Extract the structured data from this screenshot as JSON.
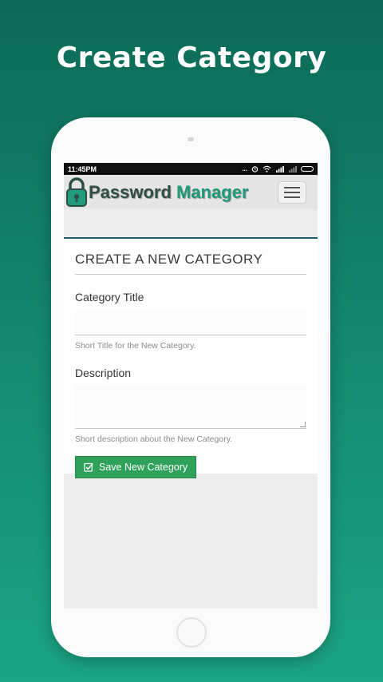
{
  "promo": {
    "title": "Create Category"
  },
  "status_bar": {
    "time": "11:45PM",
    "signal_dots": "..."
  },
  "app": {
    "logo_word_1": "Password",
    "logo_word_2": "Manager"
  },
  "form": {
    "heading": "CREATE A NEW CATEGORY",
    "title_label": "Category Title",
    "title_value": "",
    "title_help": "Short Title for the New Category.",
    "description_label": "Description",
    "description_value": "",
    "description_help": "Short description about the New Category.",
    "save_label": "Save New Category"
  },
  "colors": {
    "background_top": "#0c6a57",
    "background_bottom": "#1aa583",
    "brand_green": "#1f9b79",
    "button_green": "#2ea25a"
  },
  "icons": [
    "lock-icon",
    "wifi-icon",
    "signal-icon",
    "alarm-icon",
    "battery-icon",
    "menu-icon",
    "check-square-icon"
  ]
}
